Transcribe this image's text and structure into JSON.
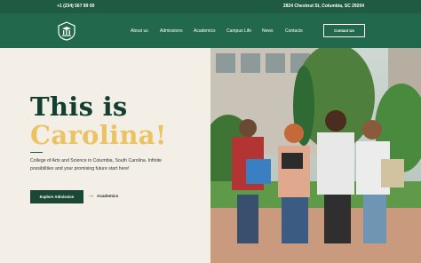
{
  "topbar": {
    "phone": "+1 (234) 567 89 00",
    "address": "2824 Chestnut St, Columbia, SC 29204"
  },
  "header": {
    "logo_icon": "university-crest-icon",
    "nav": [
      "About us",
      "Admissions",
      "Academics",
      "Campus Life",
      "News",
      "Contacts"
    ],
    "contact_button": "Contact Us"
  },
  "hero": {
    "title_line1": "This is",
    "title_line2": "Carolina!",
    "description": "College of Arts and Science in Columbia, South Carolina. Infinite possibilities and your promising future start here!",
    "primary_button": "Explore Admission",
    "secondary_link": "Academics",
    "image_icon": "students-group-photo"
  },
  "colors": {
    "topbar": "#1f5a43",
    "header": "#21684d",
    "accent_gold": "#ecc362",
    "title_green": "#123f2f",
    "background": "#f3efe7"
  }
}
